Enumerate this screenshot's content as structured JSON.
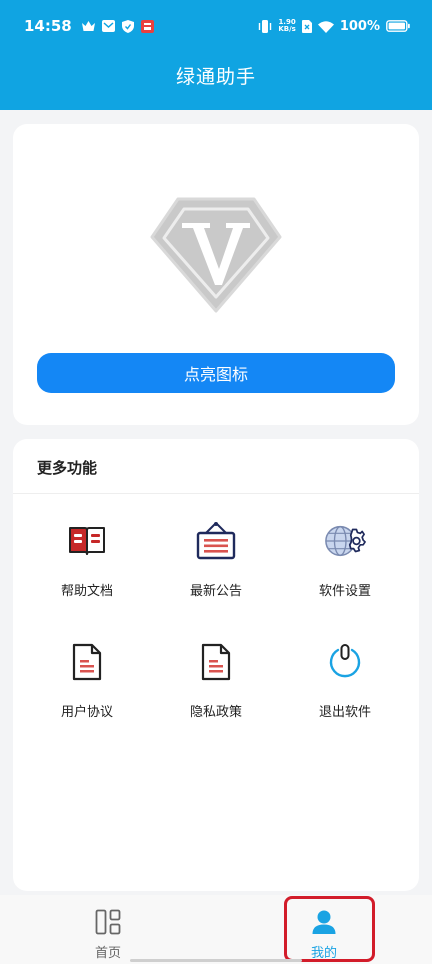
{
  "status_bar": {
    "time": "14:58",
    "speed_top": "1.90",
    "speed_bottom": "KB/s",
    "battery": "100%",
    "icons": [
      "crown-icon",
      "mail-icon",
      "shield-icon",
      "app-badge-icon",
      "vibrate-icon",
      "sim-icon",
      "wifi-icon",
      "battery-icon"
    ]
  },
  "header": {
    "title": "绿通助手"
  },
  "top_card": {
    "badge_icon": "vip-v-badge-icon",
    "button_label": "点亮图标",
    "button_color": "#1487f5"
  },
  "more": {
    "title": "更多功能",
    "items": [
      {
        "label": "帮助文档",
        "icon": "book-icon"
      },
      {
        "label": "最新公告",
        "icon": "notice-board-icon"
      },
      {
        "label": "软件设置",
        "icon": "globe-gear-icon"
      },
      {
        "label": "用户协议",
        "icon": "document-icon"
      },
      {
        "label": "隐私政策",
        "icon": "document-icon"
      },
      {
        "label": "退出软件",
        "icon": "power-icon"
      }
    ]
  },
  "nav": {
    "home_label": "首页",
    "mine_label": "我的",
    "active": "我的",
    "accent": "#1aa3e3"
  },
  "colors": {
    "header": "#10a4e2",
    "highlight": "#d21c2a"
  }
}
